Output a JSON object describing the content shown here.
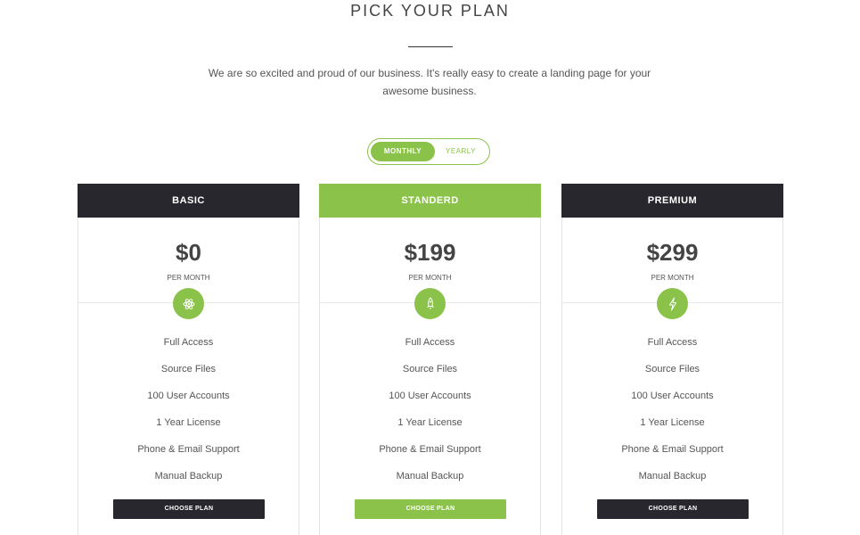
{
  "header": {
    "title": "PICK YOUR PLAN",
    "subtitle": "We are so excited and proud of our business. It's really easy to create a landing page for your awesome business."
  },
  "billing_toggle": {
    "monthly_label": "MONTHLY",
    "yearly_label": "YEARLY",
    "selected": "MONTHLY"
  },
  "colors": {
    "accent": "#8bc34a",
    "dark": "#27272d"
  },
  "plans": [
    {
      "name": "BASIC",
      "price": "$0",
      "period": "PER MONTH",
      "icon": "atom-icon",
      "features": [
        "Full Access",
        "Source Files",
        "100 User Accounts",
        "1 Year License",
        "Phone & Email Support",
        "Manual Backup"
      ],
      "button_label": "CHOOSE PLAN"
    },
    {
      "name": "STANDERD",
      "price": "$199",
      "period": "PER MONTH",
      "icon": "rocket-icon",
      "features": [
        "Full Access",
        "Source Files",
        "100 User Accounts",
        "1 Year License",
        "Phone & Email Support",
        "Manual Backup"
      ],
      "button_label": "CHOOSE PLAN"
    },
    {
      "name": "PREMIUM",
      "price": "$299",
      "period": "PER MONTH",
      "icon": "lightning-icon",
      "features": [
        "Full Access",
        "Source Files",
        "100 User Accounts",
        "1 Year License",
        "Phone & Email Support",
        "Manual Backup"
      ],
      "button_label": "CHOOSE PLAN"
    }
  ]
}
